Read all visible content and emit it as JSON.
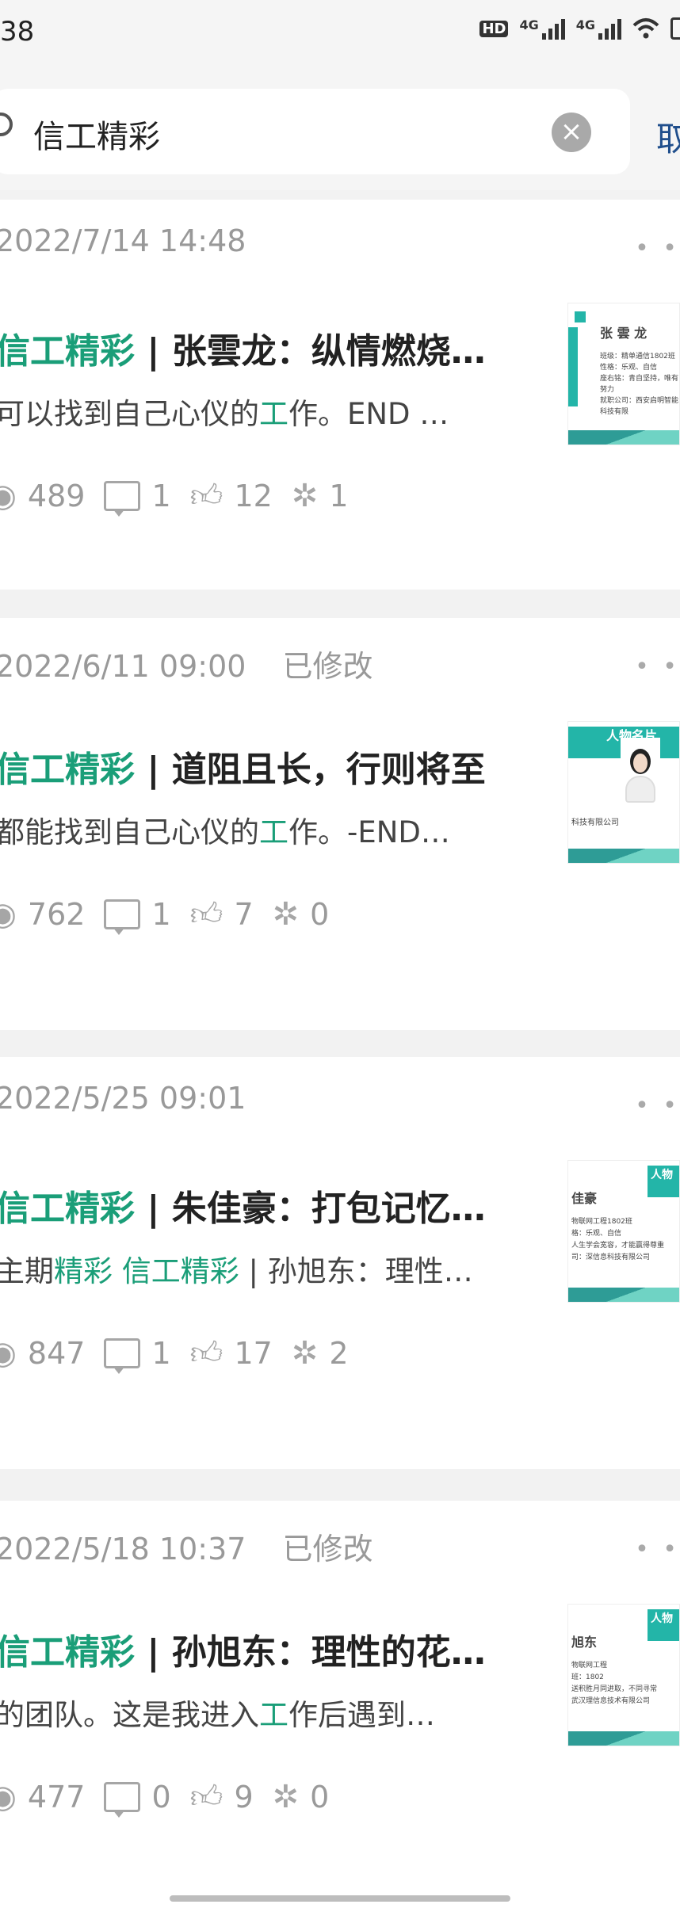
{
  "status_bar": {
    "time": "38",
    "icons": [
      "hd-icon",
      "4g-signal-icon",
      "4g-signal-icon",
      "wifi-icon",
      "battery-icon"
    ],
    "net1": "4G",
    "net2": "4G",
    "hd": "HD"
  },
  "search": {
    "query": "信工精彩",
    "cancel_label": "取"
  },
  "accent_color": "#1a9e78",
  "results": [
    {
      "date": "2022/7/14 14:48",
      "edited": "",
      "title_hl": "信工精彩",
      "title_rest": " | 张雲龙：纵情燃烧…",
      "snippet_pre": "可以找到自己心仪的",
      "snippet_hl": "工",
      "snippet_post": "作。END …",
      "views": "489",
      "comments": "1",
      "likes": "12",
      "shares": "1",
      "thumb_name": "张 雲 龙",
      "thumb_header": "",
      "thumb_lines": [
        "班级：精单通信1802班",
        "性格：乐观、自信",
        "座右铭：青自坚持，唯有努力",
        "就职公司：西安启明智能科技有限"
      ]
    },
    {
      "date": "2022/6/11 09:00",
      "edited": "已修改",
      "title_hl": "信工精彩",
      "title_rest": " | 道阻且长，行则将至",
      "snippet_pre": "都能找到自己心仪的",
      "snippet_hl": "工",
      "snippet_post": "作。-END…",
      "views": "762",
      "comments": "1",
      "likes": "7",
      "shares": "0",
      "thumb_name": "",
      "thumb_header": "人物名片",
      "thumb_lines": [
        "科技有限公司"
      ]
    },
    {
      "date": "2022/5/25 09:01",
      "edited": "",
      "title_hl": "信工精彩",
      "title_rest": " | 朱佳豪：打包记忆…",
      "snippet_pre": "主期",
      "snippet_hl": "精彩 信工精彩",
      "snippet_post": " | 孙旭东：理性…",
      "views": "847",
      "comments": "1",
      "likes": "17",
      "shares": "2",
      "thumb_name": "佳豪",
      "thumb_header": "人物",
      "thumb_lines": [
        "物联网工程1802班",
        "格：乐观、自信",
        "人生学会宽容，才能赢得尊重",
        "司：深信息科技有限公司"
      ]
    },
    {
      "date": "2022/5/18 10:37",
      "edited": "已修改",
      "title_hl": "信工精彩",
      "title_rest": " | 孙旭东：理性的花…",
      "snippet_pre": "的团队。这是我进入",
      "snippet_hl": "工",
      "snippet_post": "作后遇到…",
      "views": "477",
      "comments": "0",
      "likes": "9",
      "shares": "0",
      "thumb_name": "旭东",
      "thumb_header": "人物",
      "thumb_lines": [
        "物联网工程",
        "班：1802",
        "送积胜月同进取，不同寻常",
        "武汉理信息技术有限公司"
      ]
    }
  ]
}
